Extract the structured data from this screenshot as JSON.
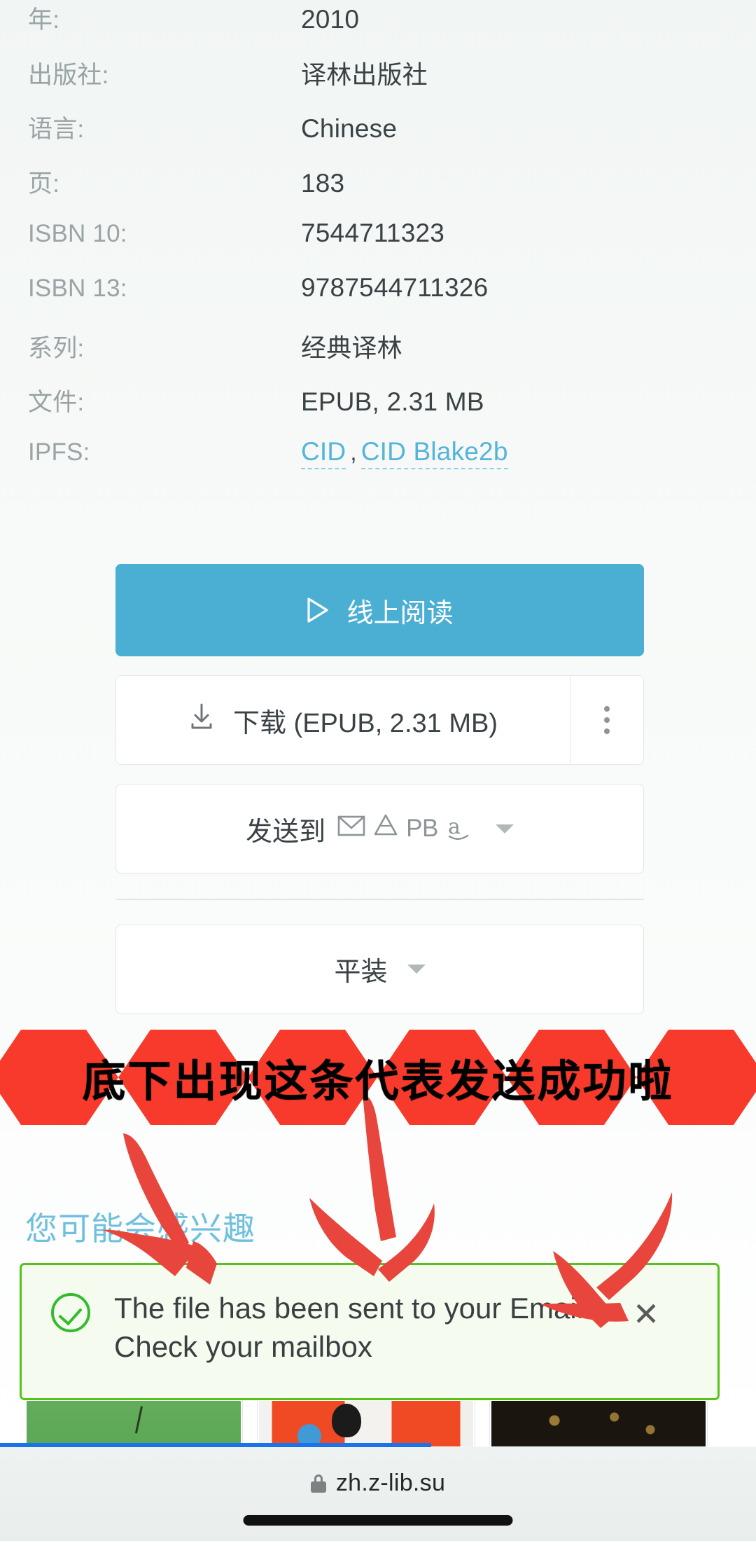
{
  "book_details": {
    "rows": [
      {
        "label": "年:",
        "value": "2010"
      },
      {
        "label": "出版社:",
        "value": "译林出版社"
      },
      {
        "label": "语言:",
        "value": "Chinese"
      },
      {
        "label": "页:",
        "value": "183"
      },
      {
        "label": "ISBN 10:",
        "value": "7544711323"
      },
      {
        "label": "ISBN 13:",
        "value": "9787544711326"
      },
      {
        "label": "系列:",
        "value": "经典译林"
      },
      {
        "label": "文件:",
        "value": "EPUB, 2.31 MB"
      }
    ],
    "ipfs": {
      "label": "IPFS:",
      "cid_label": "CID",
      "separator": ",",
      "cid_blake2b_label": "CID Blake2b"
    }
  },
  "actions": {
    "read_online_label": "线上阅读",
    "read_online_icon": "play-triangle-icon",
    "download_label": "下载 (EPUB, 2.31 MB)",
    "download_icon": "download-icon",
    "more_menu_icon": "kebab-menu-icon",
    "send_to_label": "发送到",
    "send_to_icons": [
      "email-icon",
      "google-drive-icon",
      "pocketbook-icon",
      "amazon-icon"
    ],
    "pocketbook_text": "PB",
    "amazon_text": "a",
    "format_label": "平装",
    "dropdown_icon": "chevron-down-icon"
  },
  "related": {
    "heading": "您可能会感兴趣"
  },
  "annotation": {
    "ribbon_text": "底下出现这条代表发送成功啦",
    "ribbon_color": "#F73A2B",
    "arrow_color": "#E8453C",
    "arrow_count": 3
  },
  "toast": {
    "message": "The file has been sent to your Email. Check your mailbox",
    "status_icon": "check-circle-icon",
    "close_icon": "close-icon",
    "close_label": "✕",
    "border_color": "#55C319",
    "background_color": "#F5FCEF"
  },
  "browser": {
    "url": "zh.z-lib.su",
    "lock_icon": "lock-icon",
    "progress_percent": 57,
    "progress_color": "#1A73E8"
  },
  "theme": {
    "accent_blue": "#4BAFD4",
    "link_blue": "#55B4DA",
    "heading_blue": "#6FC0DE",
    "label_gray": "#9AA3A5",
    "value_gray": "#3B4245"
  }
}
